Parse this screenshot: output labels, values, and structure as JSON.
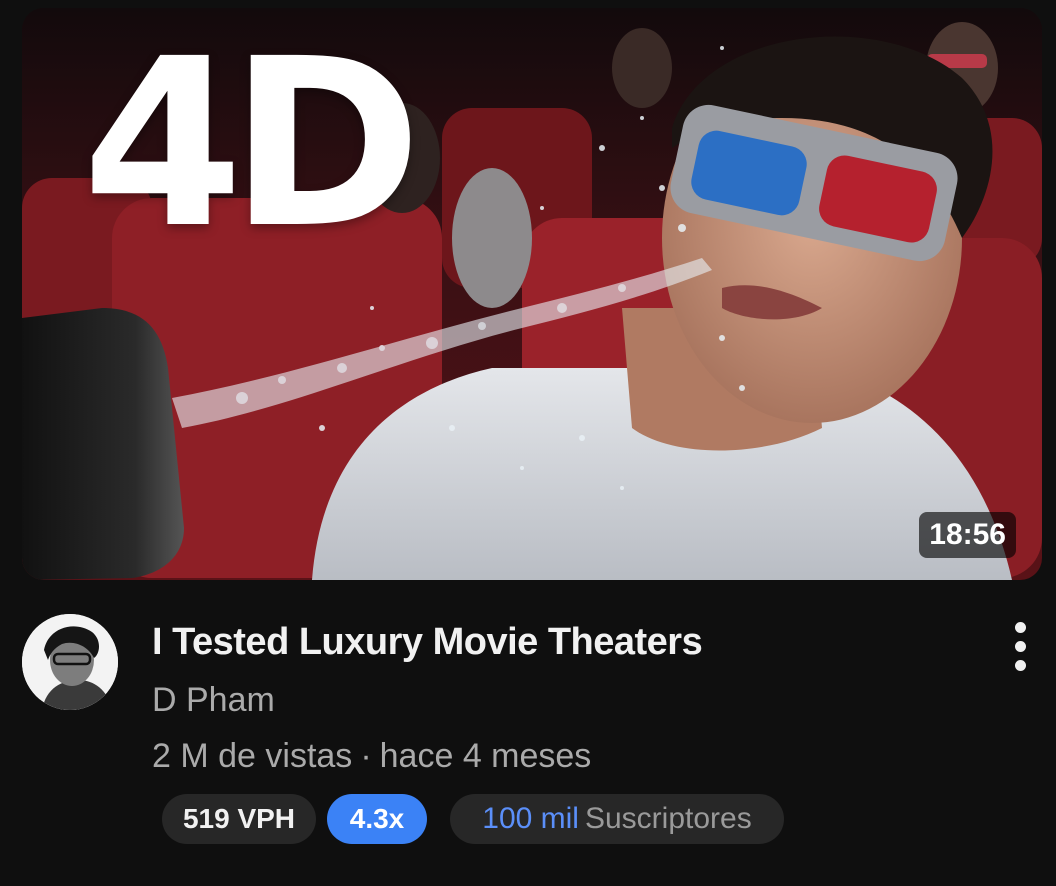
{
  "thumbnail": {
    "overlay_text": "4D",
    "duration": "18:56"
  },
  "video": {
    "title": "I Tested Luxury Movie Theaters",
    "channel": "D Pham",
    "views": "2 M de vistas",
    "separator": "·",
    "age": "hace 4 meses"
  },
  "badges": {
    "vph": "519 VPH",
    "multiplier": "4.3x",
    "subs_value": "100 mil",
    "subs_label": "Suscriptores"
  },
  "icons": {
    "more": "more-vert-icon"
  },
  "colors": {
    "background": "#0f0f0f",
    "multiplier_badge": "#3b82f6",
    "subs_value": "#5b8ff9"
  }
}
